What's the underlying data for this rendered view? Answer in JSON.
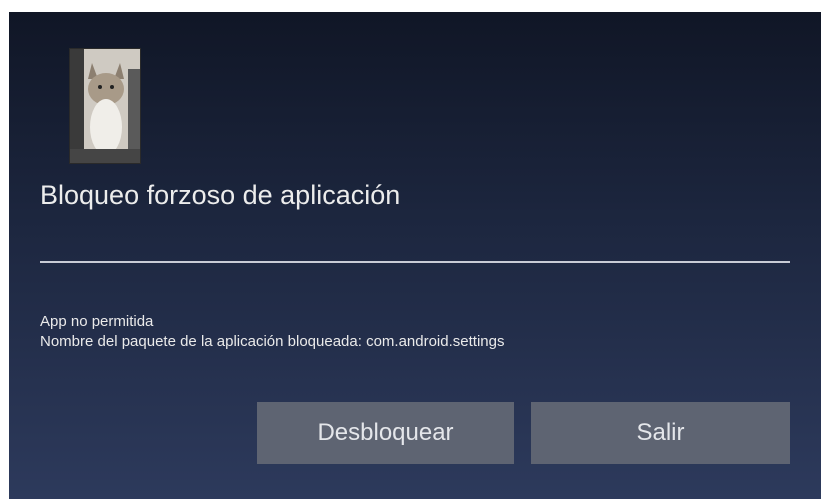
{
  "dialog": {
    "app_icon": "cat-photo-icon",
    "title": "Bloqueo forzoso de aplicación",
    "message_line1": "App no permitida",
    "message_line2": "Nombre del paquete de la aplicación bloqueada: com.android.settings",
    "buttons": {
      "unlock_label": "Desbloquear",
      "exit_label": "Salir"
    },
    "colors": {
      "background_top": "#101626",
      "background_bottom": "#2d3a5c",
      "button": "#5e6472",
      "text": "#ececec"
    }
  }
}
